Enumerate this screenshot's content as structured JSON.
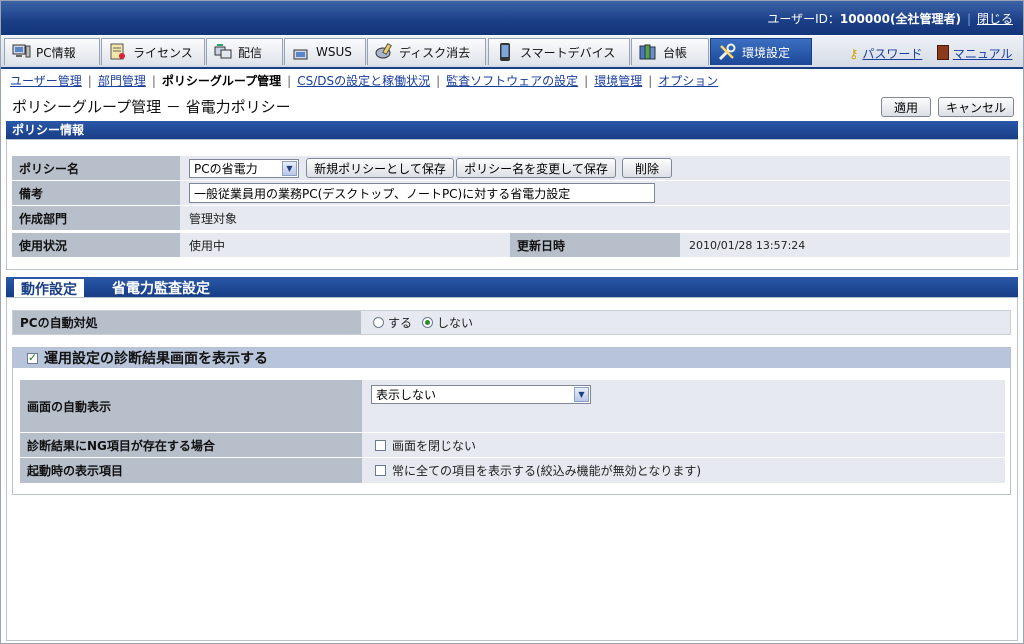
{
  "header": {
    "user_label": "ユーザーID：",
    "user_id": "100000(全社管理者)",
    "close_link": "閉じる"
  },
  "main_tabs": [
    {
      "label": "PC情報",
      "icon": "pc-icon"
    },
    {
      "label": "ライセンス",
      "icon": "license-icon"
    },
    {
      "label": "配信",
      "icon": "distribution-icon"
    },
    {
      "label": "WSUS",
      "icon": "wsus-icon",
      "icon_text": "WSUS"
    },
    {
      "label": "ディスク消去",
      "icon": "disk-erase-icon"
    },
    {
      "label": "スマートデバイス",
      "icon": "smart-device-icon"
    },
    {
      "label": "台帳",
      "icon": "ledger-icon"
    },
    {
      "label": "環境設定",
      "icon": "settings-tools-icon",
      "active": true
    }
  ],
  "top_links": {
    "password": "パスワード",
    "manual": "マニュアル"
  },
  "sub_nav": [
    {
      "label": "ユーザー管理",
      "link": true
    },
    {
      "label": "部門管理",
      "link": true
    },
    {
      "label": "ポリシーグループ管理",
      "link": false
    },
    {
      "label": "CS/DSの設定と稼働状況",
      "link": true
    },
    {
      "label": "監査ソフトウェアの設定",
      "link": true
    },
    {
      "label": "環境管理",
      "link": true
    },
    {
      "label": "オプション",
      "link": true
    }
  ],
  "page_title": "ポリシーグループ管理 － 省電力ポリシー",
  "actions": {
    "apply": "適用",
    "cancel": "キャンセル"
  },
  "policy_info": {
    "section_title": "ポリシー情報",
    "name_label": "ポリシー名",
    "name_value": "PCの省電力",
    "save_new": "新規ポリシーとして保存",
    "rename_save": "ポリシー名を変更して保存",
    "delete": "削除",
    "remark_label": "備考",
    "remark_value": "一般従業員用の業務PC(デスクトップ、ノートPC)に対する省電力設定",
    "dept_label": "作成部門",
    "dept_value": "管理対象",
    "status_label": "使用状況",
    "status_value": "使用中",
    "updated_label": "更新日時",
    "updated_value": "2010/01/28 13:57:24"
  },
  "sub_tabs": [
    {
      "label": "動作設定",
      "active": true
    },
    {
      "label": "省電力監査設定",
      "active": false
    }
  ],
  "operation": {
    "auto_label": "PCの自動対処",
    "opt_yes": "する",
    "opt_no": "しない",
    "selected": "しない",
    "group_title": "運用設定の診断結果画面を表示する",
    "group_checked": true,
    "auto_display_label": "画面の自動表示",
    "auto_display_value": "表示しない",
    "ng_label": "診断結果にNG項目が存在する場合",
    "ng_option": "画面を閉じない",
    "startup_label": "起動時の表示項目",
    "startup_option": "常に全ての項目を表示する(絞込み機能が無効となります)"
  },
  "colors": {
    "brand": "#1a3e86",
    "link": "#1a3e9e",
    "label_bg": "#b7bfcb",
    "row_bg": "#e6e9ef"
  }
}
